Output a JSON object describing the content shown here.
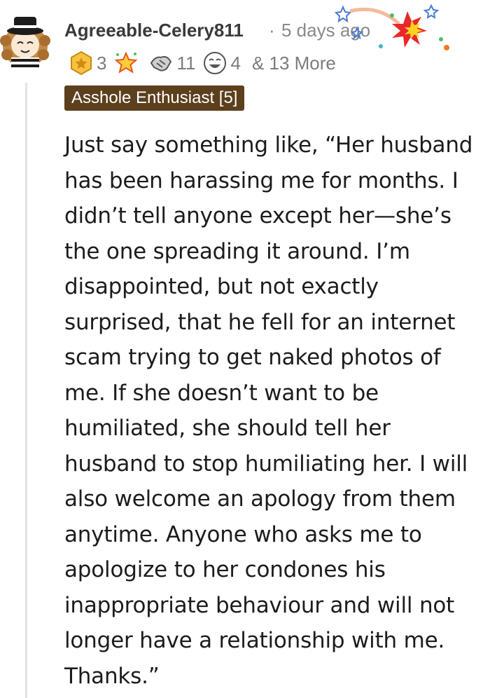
{
  "comment": {
    "username": "Agreeable-Celery811",
    "separator": "·",
    "time_ago": "5 days ago",
    "awards": [
      {
        "icon": "gold-medal-icon",
        "count": "3"
      },
      {
        "icon": "starburst-icon",
        "count": ""
      },
      {
        "icon": "handshake-icon",
        "count": "11"
      },
      {
        "icon": "laughing-face-icon",
        "count": "4"
      }
    ],
    "more_awards": "& 13 More",
    "user_flair": "Asshole Enthusiast [5]",
    "body_lines": [
      "Just say something like, “Her husband",
      "has been harassing me for months. I",
      "didn’t tell anyone except her—she’s",
      "the one spreading it around. I’m",
      "disappointed, but not exactly",
      "surprised, that he fell for an internet",
      "scam trying to get naked photos of",
      "me. If she doesn’t want to be",
      "humiliated, she should tell her",
      "husband to stop humiliating her. I will",
      "also welcome an apology from them",
      "anytime. Anyone who asks me to",
      "apologize to her condones his",
      "inappropriate behaviour and will not",
      "longer have a relationship with me.",
      "Thanks.”"
    ]
  },
  "colors": {
    "flair_background": "#5c3f1c",
    "thread_line": "#e4e4e4",
    "muted_text": "#8a8a8a"
  }
}
